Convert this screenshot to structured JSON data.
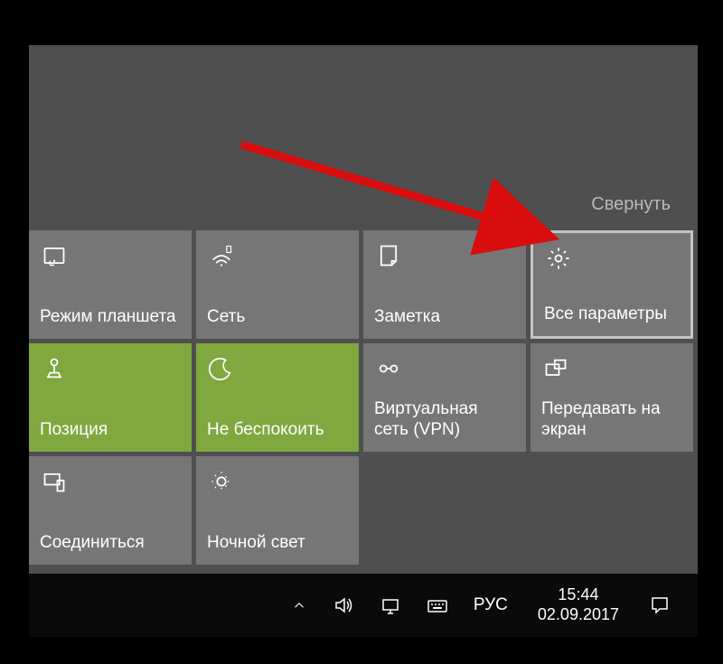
{
  "actionCenter": {
    "collapseLabel": "Свернуть",
    "tiles": [
      {
        "icon": "tablet-mode",
        "label": "Режим планшета",
        "active": false
      },
      {
        "icon": "network",
        "label": "Сеть",
        "active": false
      },
      {
        "icon": "note",
        "label": "Заметка",
        "active": false
      },
      {
        "icon": "settings",
        "label": "Все параметры",
        "active": false,
        "highlighted": true
      },
      {
        "icon": "location",
        "label": "Позиция",
        "active": true
      },
      {
        "icon": "moon",
        "label": "Не беспокоить",
        "active": true
      },
      {
        "icon": "vpn",
        "label": "Виртуальная сеть (VPN)",
        "active": false
      },
      {
        "icon": "project",
        "label": "Передавать на экран",
        "active": false
      },
      {
        "icon": "connect",
        "label": "Соединиться",
        "active": false
      },
      {
        "icon": "night-light",
        "label": "Ночной свет",
        "active": false
      }
    ]
  },
  "taskbar": {
    "language": "РУС",
    "time": "15:44",
    "date": "02.09.2017"
  },
  "annotation": {
    "arrowColor": "#d90d0d"
  }
}
